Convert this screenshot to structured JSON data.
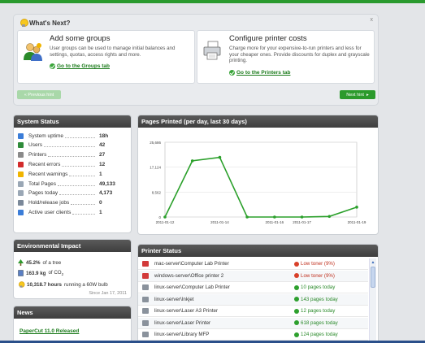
{
  "whats_next": {
    "title": "What's Next?",
    "close": "x",
    "cards": [
      {
        "title": "Add some groups",
        "desc": "User groups can be used to manage initial balances and settings, quotas, access rights and more.",
        "link": "Go to the Groups tab"
      },
      {
        "title": "Configure printer costs",
        "desc": "Charge more for your expensive-to-run printers and less for your cheaper ones. Provide discounts for duplex and grayscale printing.",
        "link": "Go to the Printers tab"
      }
    ],
    "prev_hint": "« Previous hint",
    "next_hint": "Next hint"
  },
  "system_status": {
    "title": "System Status",
    "rows": [
      {
        "label": "System uptime",
        "value": "18h",
        "icon": "clock-icon",
        "color": "#3b7dd8"
      },
      {
        "label": "Users",
        "value": "42",
        "icon": "users-icon",
        "color": "#2e8b3a"
      },
      {
        "label": "Printers",
        "value": "27",
        "icon": "printer-icon",
        "color": "#8a8a8a"
      },
      {
        "label": "Recent errors",
        "value": "12",
        "icon": "error-icon",
        "color": "#d22b2b"
      },
      {
        "label": "Recent warnings",
        "value": "1",
        "icon": "warning-icon",
        "color": "#f0b400"
      },
      {
        "label": "Total Pages",
        "value": "49,133",
        "icon": "pages-icon",
        "color": "#9aa7b5"
      },
      {
        "label": "Pages today",
        "value": "4,173",
        "icon": "pages-today-icon",
        "color": "#9aa7b5"
      },
      {
        "label": "Hold/release jobs",
        "value": "0",
        "icon": "hold-release-icon",
        "color": "#7a8899"
      },
      {
        "label": "Active user clients",
        "value": "1",
        "icon": "client-icon",
        "color": "#3b7dd8"
      }
    ]
  },
  "environment": {
    "title": "Environmental Impact",
    "trees_value": "45.2%",
    "trees_text": "of a tree",
    "co2_value": "163.9 kg",
    "co2_text": "of CO",
    "co2_sub": "2",
    "bulb_value": "10,318.7 hours",
    "bulb_text": "running a 60W bulb",
    "since": "Since Jan 17, 2011"
  },
  "news": {
    "title": "News",
    "item": "PaperCut 11.0 Released"
  },
  "pages_printed": {
    "title": "Pages Printed (per day, last 30 days)"
  },
  "chart_data": {
    "type": "line",
    "title": "Pages Printed (per day, last 30 days)",
    "x": [
      "2011-01-12",
      "2011-01-13",
      "2011-01-14",
      "2011-01-15",
      "2011-01-16",
      "2011-01-17",
      "2011-01-18",
      "2011-01-19"
    ],
    "xticks": [
      "2011-01-12",
      "2011-01-14",
      "2011-01-16",
      "2011-01-17",
      "2011-01-19"
    ],
    "values": [
      0,
      19300,
      20500,
      0,
      0,
      0,
      200,
      3400
    ],
    "yticks": [
      "0",
      "8,562",
      "17,124",
      "25,686"
    ],
    "ylim": [
      0,
      25686
    ],
    "series_color": "#2ba02b"
  },
  "printer_status": {
    "title": "Printer Status",
    "rows": [
      {
        "name": "mac-server\\Computer Lab Printer",
        "status": "Low toner (9%)",
        "kind": "error"
      },
      {
        "name": "windows-server\\Office printer 2",
        "status": "Low toner (9%)",
        "kind": "error"
      },
      {
        "name": "linux-server\\Computer Lab Printer",
        "status": "10 pages today",
        "kind": "ok"
      },
      {
        "name": "linux-server\\Inkjet",
        "status": "143 pages today",
        "kind": "ok"
      },
      {
        "name": "linux-server\\Laser A3 Printer",
        "status": "12 pages today",
        "kind": "ok"
      },
      {
        "name": "linux-server\\Laser Printer",
        "status": "618 pages today",
        "kind": "ok"
      },
      {
        "name": "linux-server\\Library MFP",
        "status": "124 pages today",
        "kind": "ok"
      }
    ]
  }
}
